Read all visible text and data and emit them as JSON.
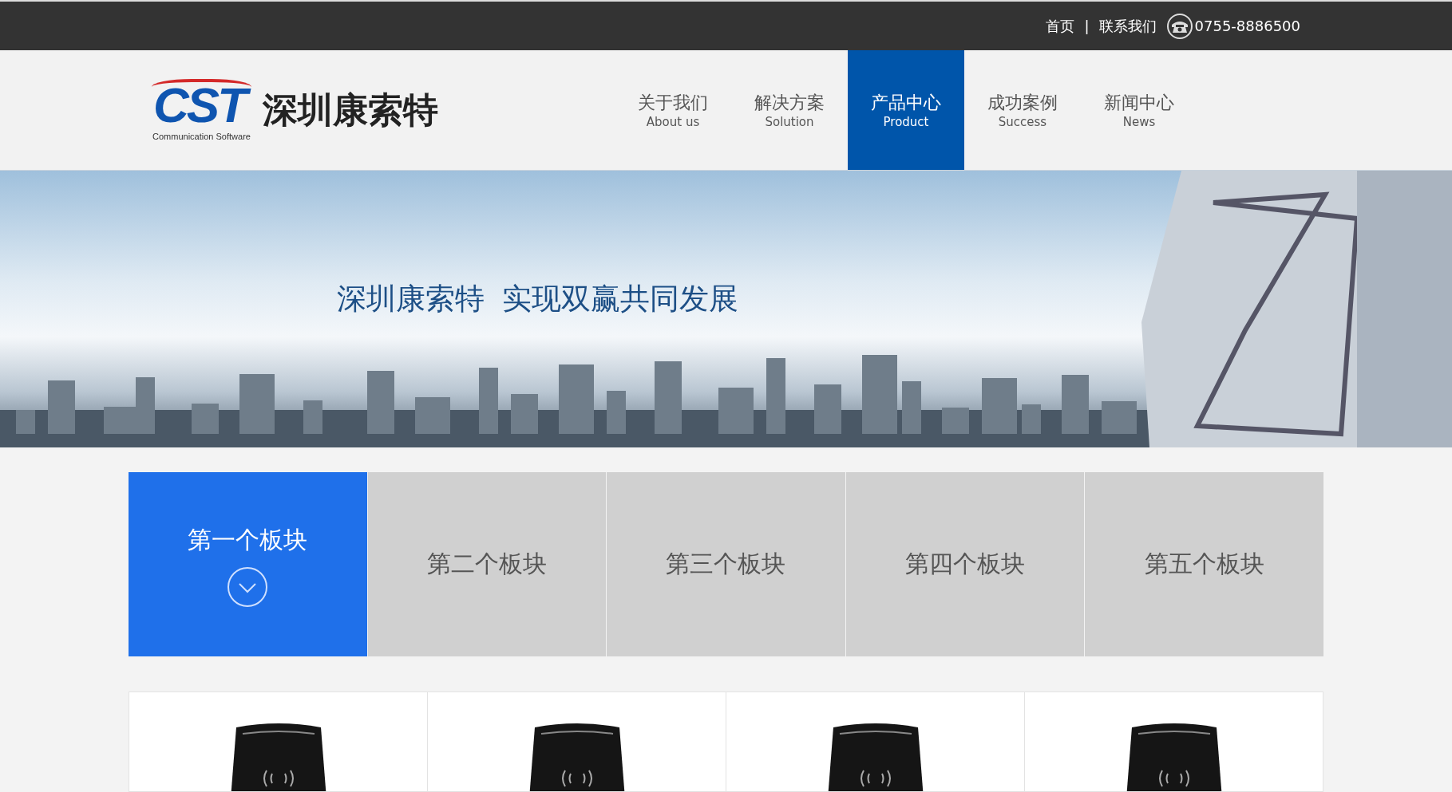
{
  "top_bar": {
    "links": [
      "首页",
      "联系我们"
    ],
    "separator": "|",
    "phone": "0755-8886500"
  },
  "header": {
    "logo": {
      "mark": "CST",
      "tagline": "Communication Software",
      "name": "深圳康索特"
    },
    "nav": [
      {
        "label": "关于我们",
        "sub": "About us",
        "selected": false
      },
      {
        "label": "解决方案",
        "sub": "Solution",
        "selected": false
      },
      {
        "label": "产品中心",
        "sub": "Product",
        "selected": true
      },
      {
        "label": "成功案例",
        "sub": "Success",
        "selected": false
      },
      {
        "label": "新闻中心",
        "sub": "News",
        "selected": false
      }
    ]
  },
  "banner": {
    "slogan": [
      "深圳康索特",
      "实现双赢共同发展"
    ]
  },
  "blocks": [
    {
      "label": "第一个板块",
      "selected": true
    },
    {
      "label": "第二个板块",
      "selected": false
    },
    {
      "label": "第三个板块",
      "selected": false
    },
    {
      "label": "第四个板块",
      "selected": false
    },
    {
      "label": "第五个板块",
      "selected": false
    }
  ],
  "products": [
    {
      "kind": "card-reader"
    },
    {
      "kind": "card-reader"
    },
    {
      "kind": "card-reader"
    },
    {
      "kind": "card-reader"
    }
  ]
}
